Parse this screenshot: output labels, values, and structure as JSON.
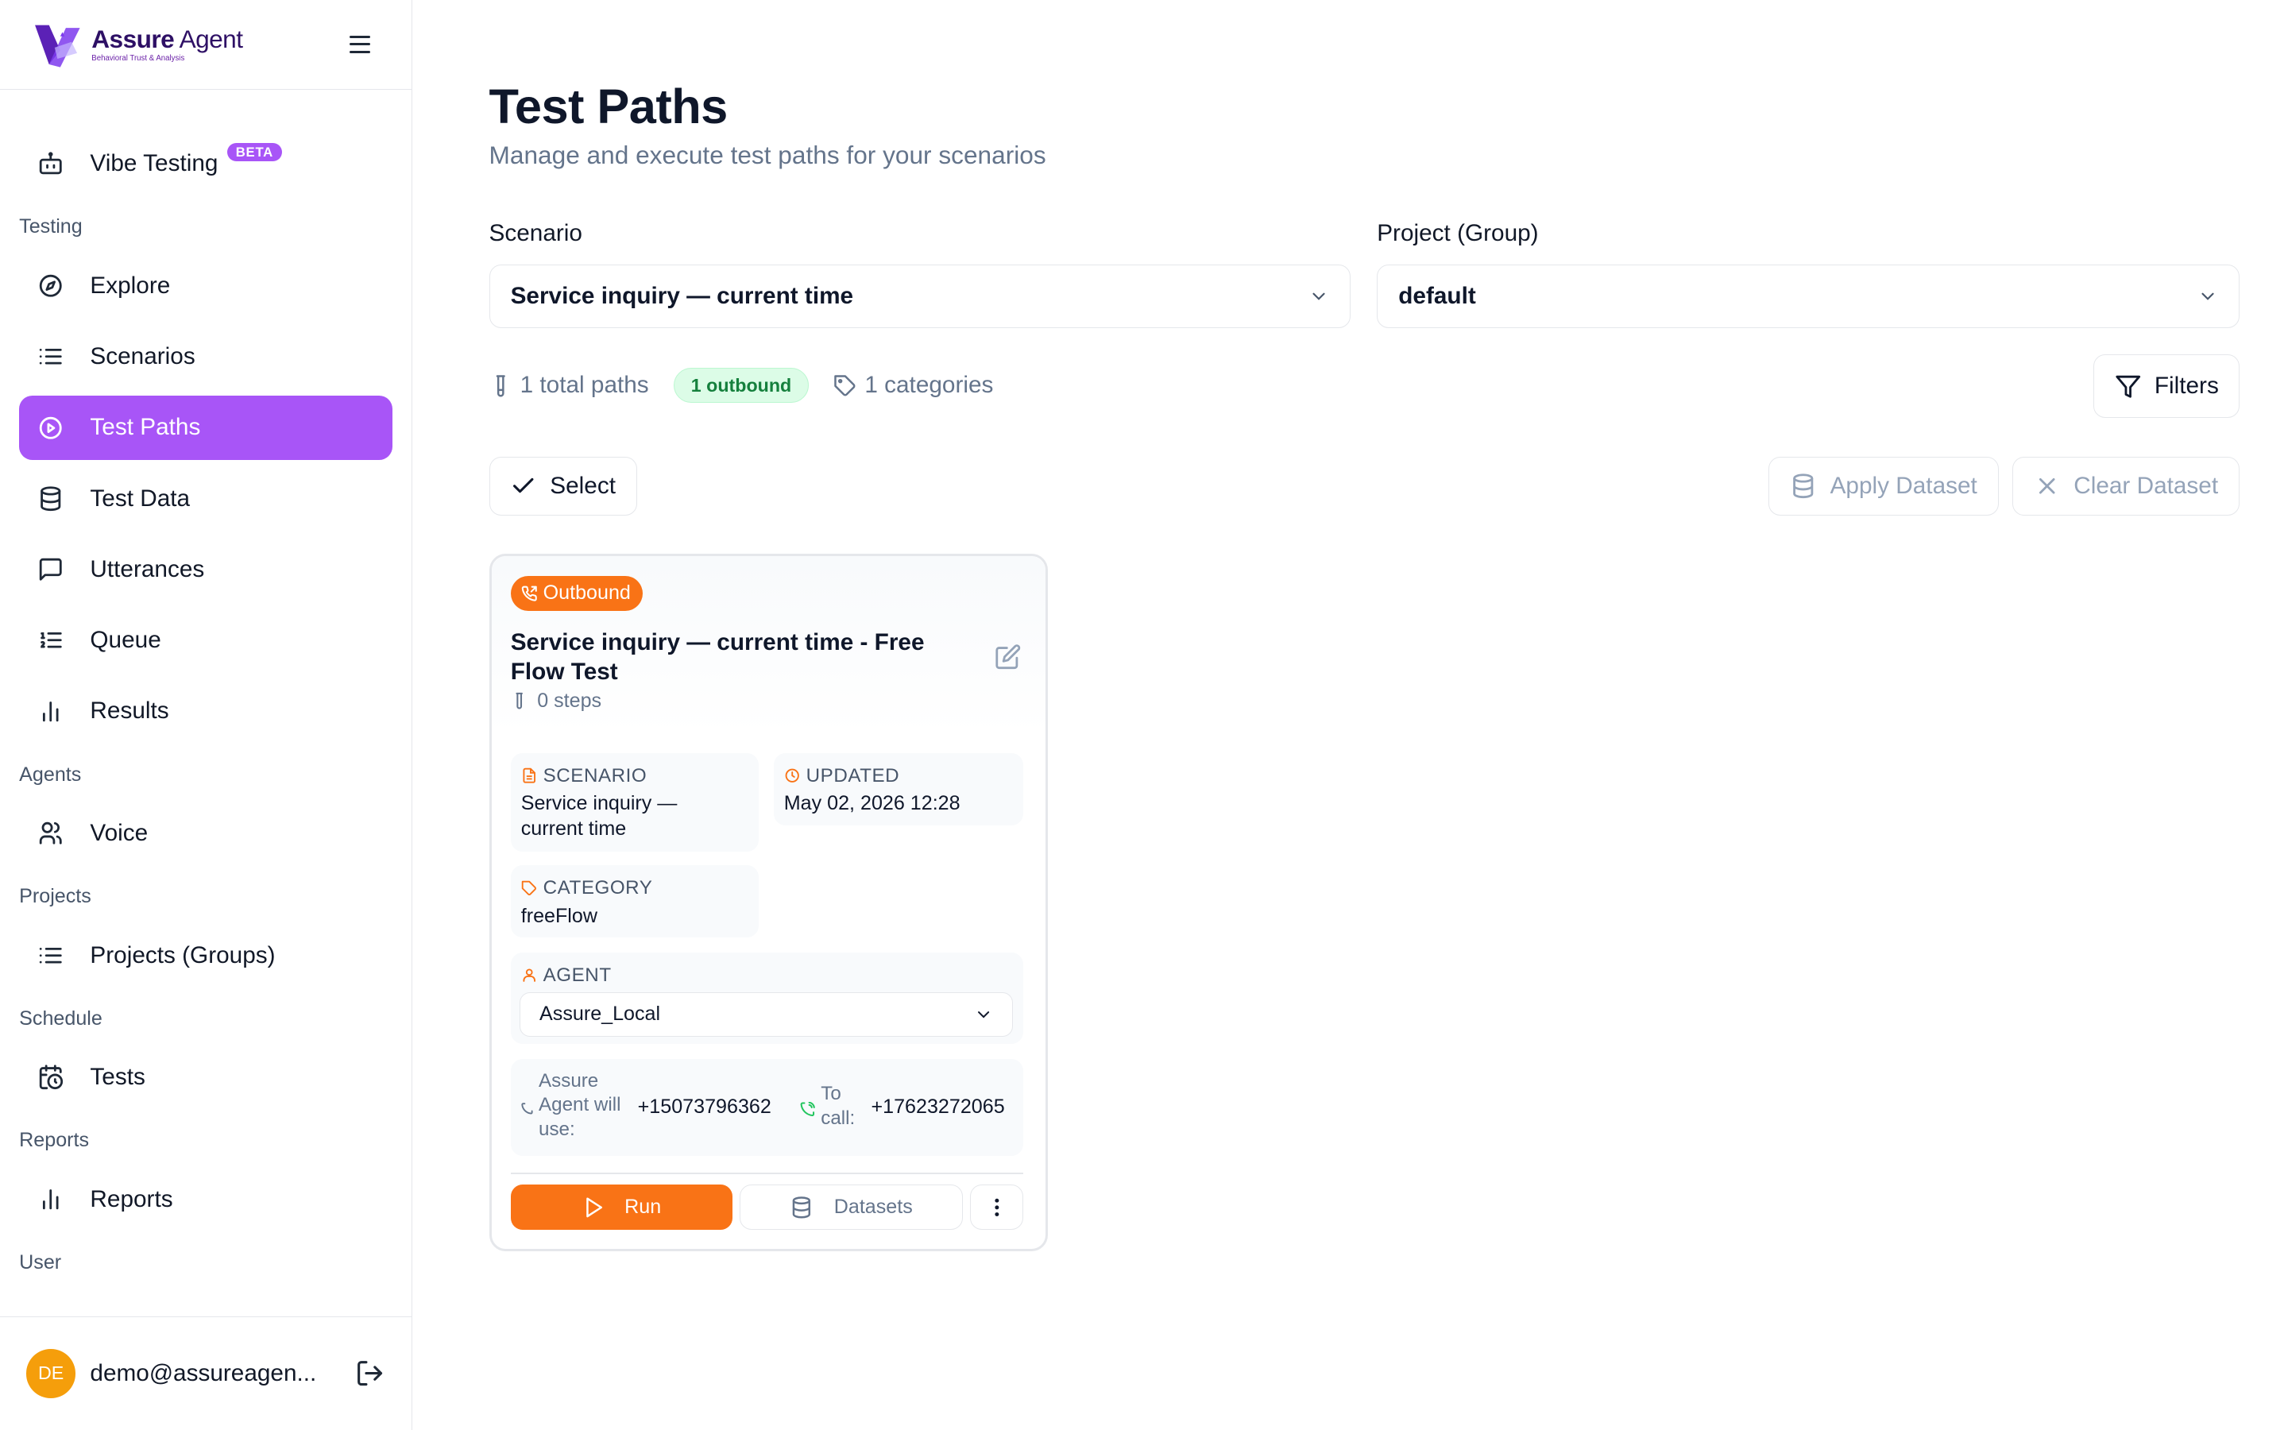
{
  "brand": {
    "name_bold": "Assure",
    "name_light": " Agent",
    "tagline": "Behavioral Trust & Analysis"
  },
  "sidebar": {
    "vibe": {
      "label": "Vibe Testing",
      "badge": "BETA"
    },
    "sections": {
      "testing": "Testing",
      "agents": "Agents",
      "projects": "Projects",
      "schedule": "Schedule",
      "reports": "Reports",
      "user": "User"
    },
    "items": {
      "explore": "Explore",
      "scenarios": "Scenarios",
      "test_paths": "Test Paths",
      "test_data": "Test Data",
      "utterances": "Utterances",
      "queue": "Queue",
      "results": "Results",
      "voice": "Voice",
      "projects_groups": "Projects (Groups)",
      "tests": "Tests",
      "reports": "Reports"
    },
    "active_item": "test_paths",
    "user": {
      "initials": "DE",
      "email": "demo@assureagen..."
    }
  },
  "header": {
    "title": "Test Paths",
    "subtitle": "Manage and execute test paths for your scenarios"
  },
  "filters": {
    "scenario_label": "Scenario",
    "scenario_value": "Service inquiry — current time",
    "project_label": "Project (Group)",
    "project_value": "default"
  },
  "stats": {
    "total_paths": "1 total paths",
    "outbound": "1 outbound",
    "categories": "1 categories"
  },
  "toolbar": {
    "filters": "Filters",
    "select": "Select",
    "apply_dataset": "Apply Dataset",
    "clear_dataset": "Clear Dataset"
  },
  "card": {
    "badge": "Outbound",
    "title": "Service inquiry — current time - Free Flow Test",
    "steps": "0 steps",
    "scenario_label": "SCENARIO",
    "scenario_value": "Service inquiry — current time",
    "updated_label": "UPDATED",
    "updated_value": "May 02, 2026 12:28",
    "category_label": "CATEGORY",
    "category_value": "freeFlow",
    "agent_label": "AGENT",
    "agent_value": "Assure_Local",
    "from_label": "Assure Agent will use:",
    "from_number": "+15073796362",
    "to_label": "To call:",
    "to_number": "+17623272065",
    "run": "Run",
    "datasets": "Datasets"
  },
  "colors": {
    "accent": "#a855f7",
    "orange": "#f97316",
    "green_bg": "#dcfce7",
    "green_text": "#15803d",
    "avatar": "#f59e0b"
  }
}
